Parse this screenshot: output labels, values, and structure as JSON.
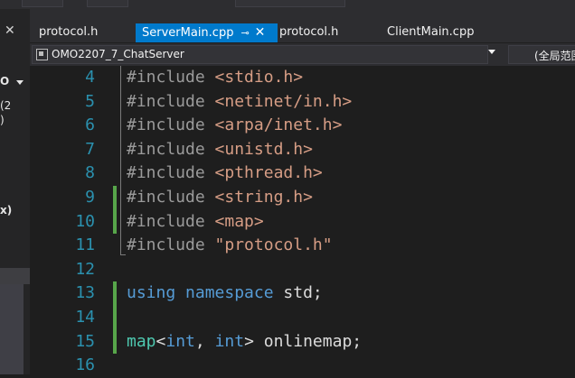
{
  "left_panel": {
    "close": "✕",
    "texts": [
      "O",
      "(2",
      ")",
      "x)"
    ]
  },
  "tabs": [
    {
      "label": "protocol.h",
      "active": false
    },
    {
      "label": "ServerMain.cpp",
      "active": true,
      "pin": "⊸",
      "close": "✕"
    },
    {
      "label": "protocol.h",
      "active": false
    },
    {
      "label": "ClientMain.cpp",
      "active": false
    }
  ],
  "navbar": {
    "project": "OMO2207_7_ChatServer",
    "scope": "(全局范围)"
  },
  "editor": {
    "lines": [
      {
        "n": "4",
        "tokens": [
          {
            "t": "#include ",
            "c": "pp"
          },
          {
            "t": "<stdio.h>",
            "c": "inc"
          }
        ]
      },
      {
        "n": "5",
        "tokens": [
          {
            "t": "#include ",
            "c": "pp"
          },
          {
            "t": "<netinet/in.h>",
            "c": "inc"
          }
        ]
      },
      {
        "n": "6",
        "tokens": [
          {
            "t": "#include ",
            "c": "pp"
          },
          {
            "t": "<arpa/inet.h>",
            "c": "inc"
          }
        ]
      },
      {
        "n": "7",
        "tokens": [
          {
            "t": "#include ",
            "c": "pp"
          },
          {
            "t": "<unistd.h>",
            "c": "inc"
          }
        ]
      },
      {
        "n": "8",
        "tokens": [
          {
            "t": "#include ",
            "c": "pp"
          },
          {
            "t": "<pthread.h>",
            "c": "inc"
          }
        ]
      },
      {
        "n": "9",
        "tokens": [
          {
            "t": "#include ",
            "c": "pp"
          },
          {
            "t": "<string.h>",
            "c": "inc"
          }
        ],
        "changed": true
      },
      {
        "n": "10",
        "tokens": [
          {
            "t": "#include ",
            "c": "pp"
          },
          {
            "t": "<map>",
            "c": "inc"
          }
        ],
        "changed": true
      },
      {
        "n": "11",
        "tokens": [
          {
            "t": "#include ",
            "c": "pp"
          },
          {
            "t": "\"protocol.h\"",
            "c": "inc"
          }
        ]
      },
      {
        "n": "12",
        "tokens": []
      },
      {
        "n": "13",
        "tokens": [
          {
            "t": "using",
            "c": "kw"
          },
          {
            "t": " ",
            "c": "pu"
          },
          {
            "t": "namespace",
            "c": "kw"
          },
          {
            "t": " std;",
            "c": "pu"
          }
        ],
        "changed": true
      },
      {
        "n": "14",
        "tokens": [],
        "changed": true
      },
      {
        "n": "15",
        "tokens": [
          {
            "t": "map",
            "c": "ty"
          },
          {
            "t": "<",
            "c": "pu"
          },
          {
            "t": "int",
            "c": "kw"
          },
          {
            "t": ", ",
            "c": "pu"
          },
          {
            "t": "int",
            "c": "kw"
          },
          {
            "t": "> onlinemap;",
            "c": "pu"
          }
        ],
        "changed": true
      },
      {
        "n": "16",
        "tokens": []
      }
    ]
  },
  "colors": {
    "accent": "#007acc",
    "line_number": "#2b91af",
    "keyword": "#569cd6",
    "include_string": "#d69d85",
    "type": "#4ec9b0",
    "change_bar": "#57a64a"
  }
}
